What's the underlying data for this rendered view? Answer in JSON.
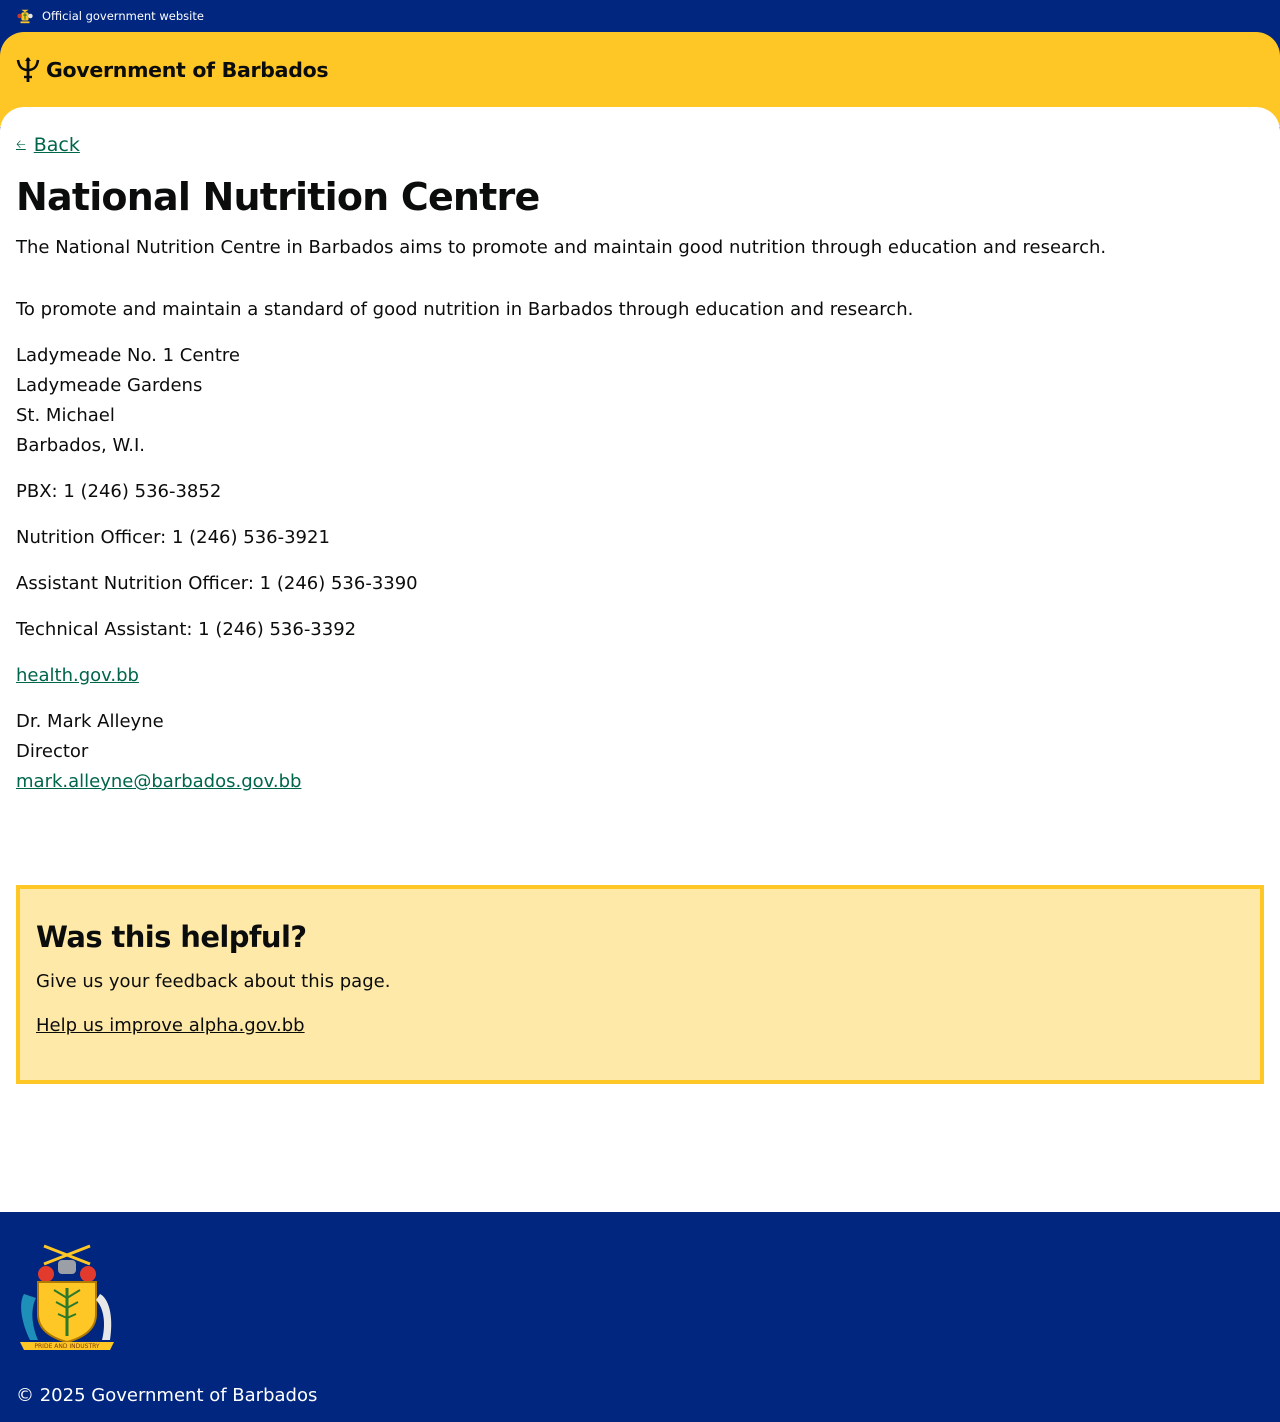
{
  "topbar": {
    "label": "Official government website",
    "icon": "coat-of-arms-icon"
  },
  "header": {
    "brand": "Government of Barbados",
    "icon": "trident-icon",
    "bg_color": "#ffc726"
  },
  "nav": {
    "back_label": "Back"
  },
  "page": {
    "title": "National Nutrition Centre",
    "lead": "The National Nutrition Centre in Barbados aims to promote and maintain good nutrition through education and research.",
    "mission": "To promote and maintain a standard of good nutrition in Barbados through education and research.",
    "address": [
      "Ladymeade No. 1 Centre",
      "Ladymeade Gardens",
      "St. Michael",
      "Barbados, W.I."
    ],
    "phones": [
      "PBX: 1 (246) 536-3852",
      "Nutrition Officer: 1 (246) 536-3921",
      "Assistant Nutrition Officer: 1 (246) 536-3390",
      "Technical Assistant: 1 (246) 536-3392"
    ],
    "website": "health.gov.bb",
    "contact": {
      "name": "Dr. Mark Alleyne",
      "role": "Director",
      "email": "mark.alleyne@barbados.gov.bb"
    }
  },
  "feedback": {
    "heading": "Was this helpful?",
    "text": "Give us your feedback about this page.",
    "link": "Help us improve alpha.gov.bb"
  },
  "footer": {
    "copyright": "© 2025 Government of Barbados",
    "icon": "coat-of-arms-icon"
  },
  "colors": {
    "navy": "#00267f",
    "gold": "#ffc726",
    "link_green": "#00654a",
    "feedback_bg": "#ffe9a8"
  }
}
